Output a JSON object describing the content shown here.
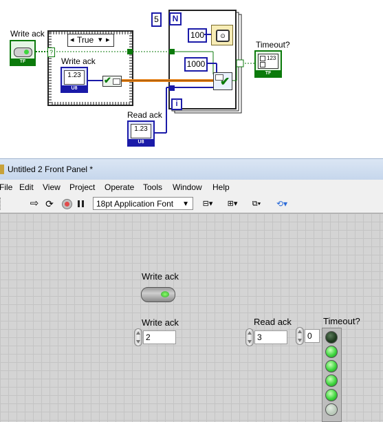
{
  "block_diagram": {
    "write_ack_bool_label": "Write ack",
    "write_ack_bool_type": "TF",
    "case_selector": "True",
    "case_question": "?",
    "write_ack_num_label": "Write ack",
    "write_ack_num_value": "1.23",
    "write_ack_num_type": "U8",
    "for_count": "5",
    "for_n": "N",
    "for_i": "i",
    "const_100": "100",
    "const_1000": "1000",
    "read_ack_label": "Read ack",
    "read_ack_value": "1.23",
    "read_ack_type": "U8",
    "timeout_label": "Timeout?",
    "timeout_value": "123",
    "timeout_type": "TF",
    "wire_colors": {
      "boolean": "#0b7a0b",
      "numeric": "#1a1aa8",
      "cluster": "#f08a1e"
    }
  },
  "window": {
    "title": "Untitled 2 Front Panel *"
  },
  "menu": [
    "File",
    "Edit",
    "View",
    "Project",
    "Operate",
    "Tools",
    "Window",
    "Help"
  ],
  "toolbar": {
    "font_select": "18pt Application Font",
    "icons": [
      "run-arrow-icon",
      "run-continuously-icon",
      "abort-icon",
      "pause-icon",
      "align-icon",
      "distribute-icon",
      "resize-icon",
      "reorder-icon"
    ]
  },
  "front_panel": {
    "write_ack_button_label": "Write ack",
    "write_ack_num_label": "Write ack",
    "write_ack_num_value": "2",
    "read_ack_label": "Read ack",
    "read_ack_value": "3",
    "read_ack_index": "0",
    "timeout_label": "Timeout?",
    "led_states": [
      false,
      true,
      true,
      true,
      true,
      false
    ],
    "colors": {
      "led_on": "#3fd63f",
      "led_off": "#1f3b1f",
      "led_dim": "#b9c9b9"
    }
  }
}
